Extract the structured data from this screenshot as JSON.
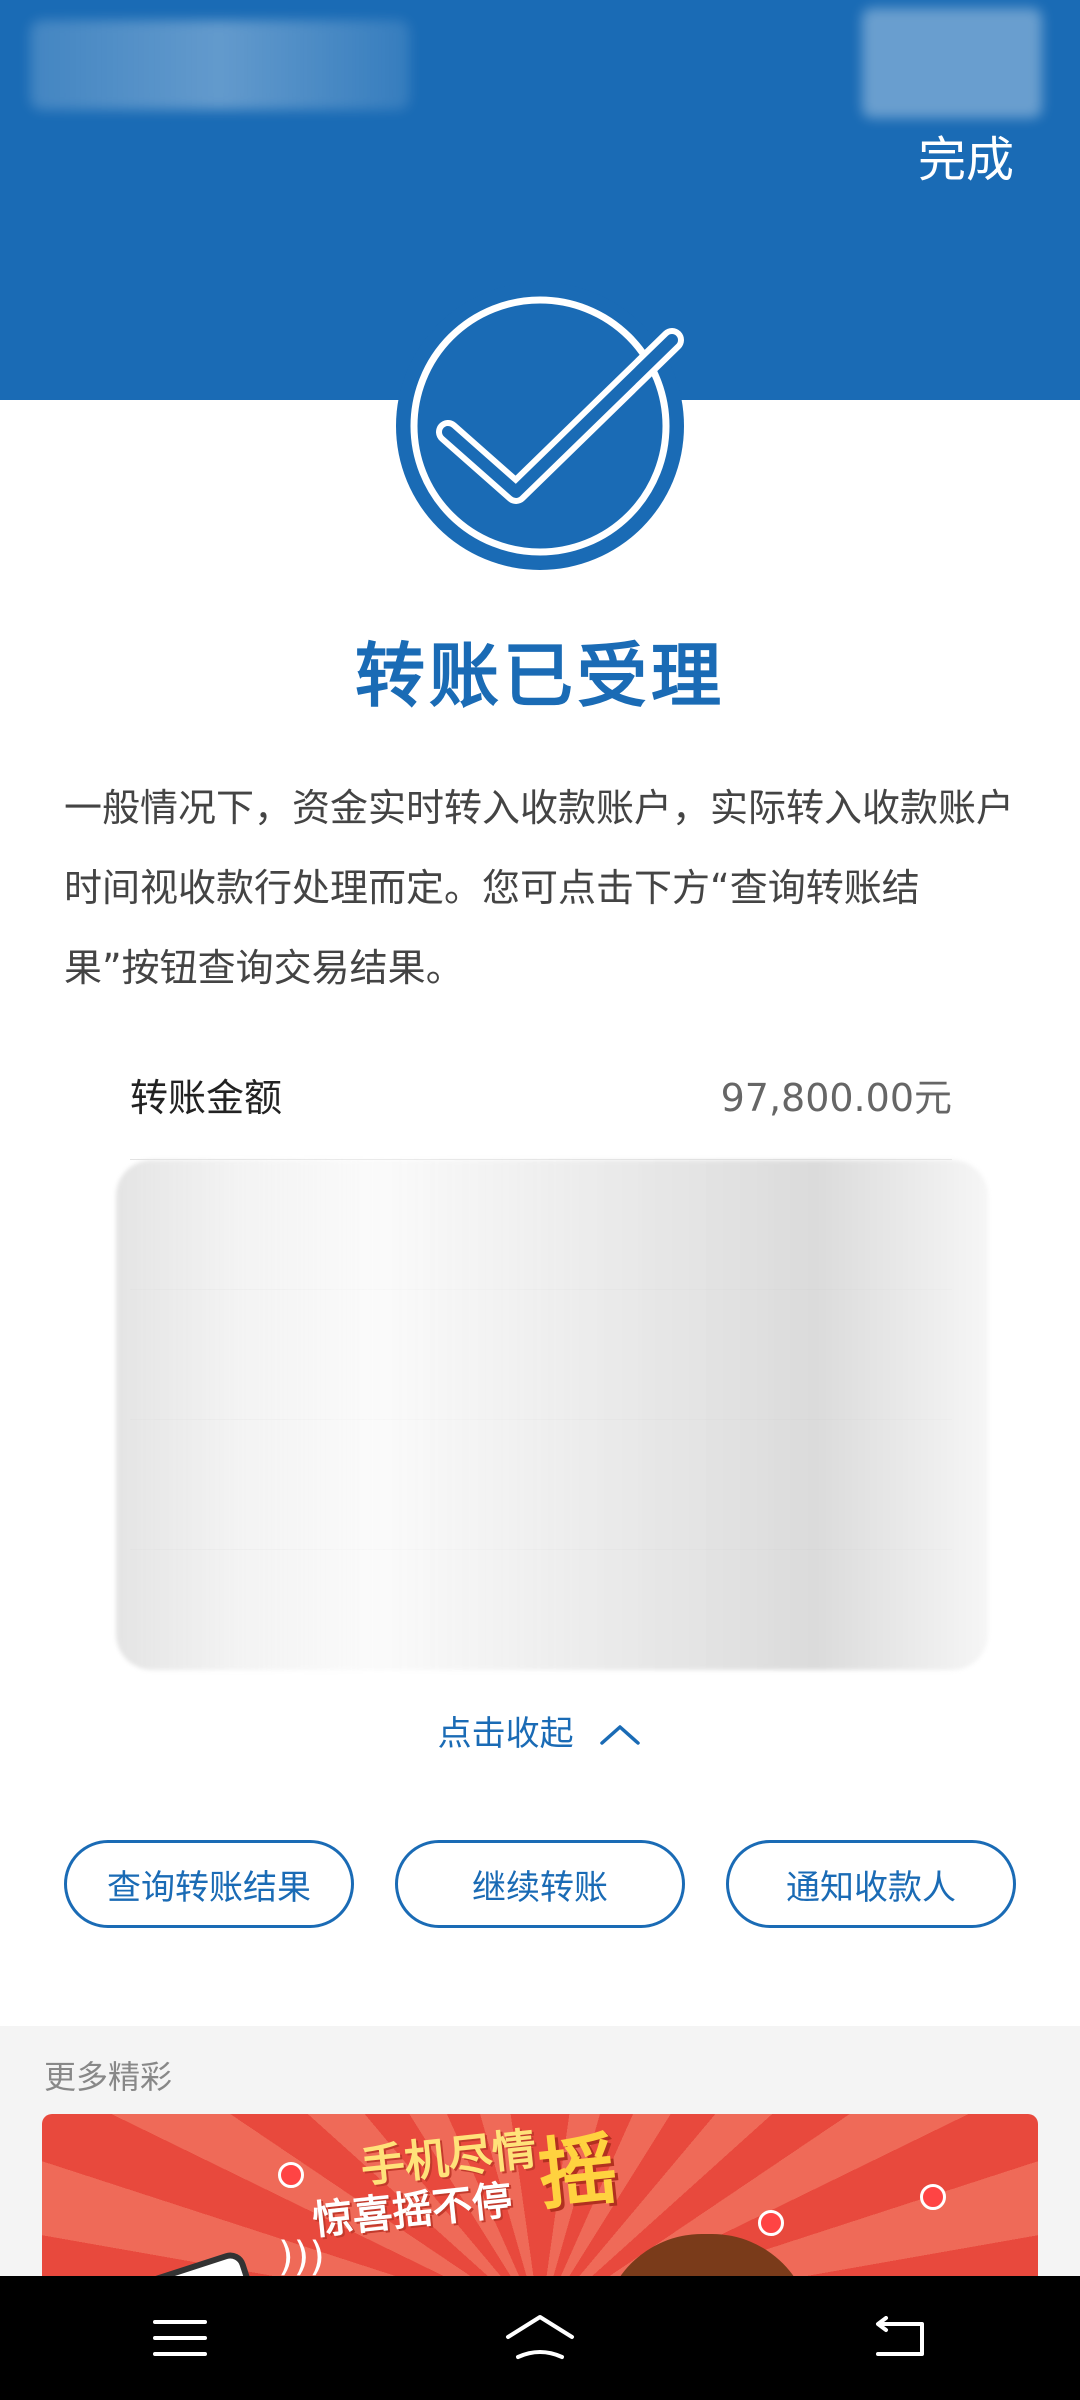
{
  "header": {
    "done_label": "完成"
  },
  "result": {
    "title": "转账已受理",
    "description": "一般情况下，资金实时转入收款账户，实际转入收款账户时间视收款行处理而定。您可点击下方“查询转账结果”按钮查询交易结果。"
  },
  "details": {
    "amount_label": "转账金额",
    "amount_value": "97,800.00元"
  },
  "collapse_label": "点击收起",
  "actions": {
    "query_label": "查询转账结果",
    "continue_label": "继续转账",
    "notify_label": "通知收款人"
  },
  "more": {
    "title": "更多精彩",
    "banner_line1": "手机尽情",
    "banner_line2": "惊喜摇不停",
    "banner_big": "摇"
  },
  "colors": {
    "brand": "#1a6bb5",
    "banner_red": "#e8493d"
  }
}
